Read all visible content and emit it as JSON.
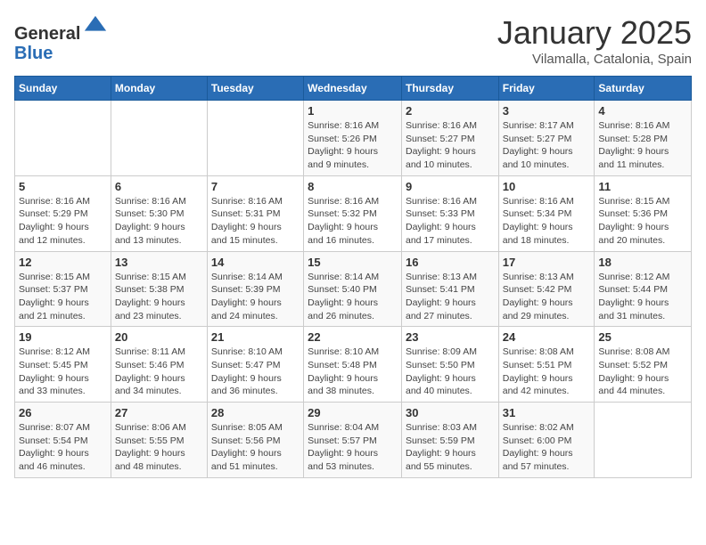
{
  "header": {
    "logo_general": "General",
    "logo_blue": "Blue",
    "month_title": "January 2025",
    "subtitle": "Vilamalla, Catalonia, Spain"
  },
  "weekdays": [
    "Sunday",
    "Monday",
    "Tuesday",
    "Wednesday",
    "Thursday",
    "Friday",
    "Saturday"
  ],
  "weeks": [
    [
      {
        "day": "",
        "info": ""
      },
      {
        "day": "",
        "info": ""
      },
      {
        "day": "",
        "info": ""
      },
      {
        "day": "1",
        "info": "Sunrise: 8:16 AM\nSunset: 5:26 PM\nDaylight: 9 hours\nand 9 minutes."
      },
      {
        "day": "2",
        "info": "Sunrise: 8:16 AM\nSunset: 5:27 PM\nDaylight: 9 hours\nand 10 minutes."
      },
      {
        "day": "3",
        "info": "Sunrise: 8:17 AM\nSunset: 5:27 PM\nDaylight: 9 hours\nand 10 minutes."
      },
      {
        "day": "4",
        "info": "Sunrise: 8:16 AM\nSunset: 5:28 PM\nDaylight: 9 hours\nand 11 minutes."
      }
    ],
    [
      {
        "day": "5",
        "info": "Sunrise: 8:16 AM\nSunset: 5:29 PM\nDaylight: 9 hours\nand 12 minutes."
      },
      {
        "day": "6",
        "info": "Sunrise: 8:16 AM\nSunset: 5:30 PM\nDaylight: 9 hours\nand 13 minutes."
      },
      {
        "day": "7",
        "info": "Sunrise: 8:16 AM\nSunset: 5:31 PM\nDaylight: 9 hours\nand 15 minutes."
      },
      {
        "day": "8",
        "info": "Sunrise: 8:16 AM\nSunset: 5:32 PM\nDaylight: 9 hours\nand 16 minutes."
      },
      {
        "day": "9",
        "info": "Sunrise: 8:16 AM\nSunset: 5:33 PM\nDaylight: 9 hours\nand 17 minutes."
      },
      {
        "day": "10",
        "info": "Sunrise: 8:16 AM\nSunset: 5:34 PM\nDaylight: 9 hours\nand 18 minutes."
      },
      {
        "day": "11",
        "info": "Sunrise: 8:15 AM\nSunset: 5:36 PM\nDaylight: 9 hours\nand 20 minutes."
      }
    ],
    [
      {
        "day": "12",
        "info": "Sunrise: 8:15 AM\nSunset: 5:37 PM\nDaylight: 9 hours\nand 21 minutes."
      },
      {
        "day": "13",
        "info": "Sunrise: 8:15 AM\nSunset: 5:38 PM\nDaylight: 9 hours\nand 23 minutes."
      },
      {
        "day": "14",
        "info": "Sunrise: 8:14 AM\nSunset: 5:39 PM\nDaylight: 9 hours\nand 24 minutes."
      },
      {
        "day": "15",
        "info": "Sunrise: 8:14 AM\nSunset: 5:40 PM\nDaylight: 9 hours\nand 26 minutes."
      },
      {
        "day": "16",
        "info": "Sunrise: 8:13 AM\nSunset: 5:41 PM\nDaylight: 9 hours\nand 27 minutes."
      },
      {
        "day": "17",
        "info": "Sunrise: 8:13 AM\nSunset: 5:42 PM\nDaylight: 9 hours\nand 29 minutes."
      },
      {
        "day": "18",
        "info": "Sunrise: 8:12 AM\nSunset: 5:44 PM\nDaylight: 9 hours\nand 31 minutes."
      }
    ],
    [
      {
        "day": "19",
        "info": "Sunrise: 8:12 AM\nSunset: 5:45 PM\nDaylight: 9 hours\nand 33 minutes."
      },
      {
        "day": "20",
        "info": "Sunrise: 8:11 AM\nSunset: 5:46 PM\nDaylight: 9 hours\nand 34 minutes."
      },
      {
        "day": "21",
        "info": "Sunrise: 8:10 AM\nSunset: 5:47 PM\nDaylight: 9 hours\nand 36 minutes."
      },
      {
        "day": "22",
        "info": "Sunrise: 8:10 AM\nSunset: 5:48 PM\nDaylight: 9 hours\nand 38 minutes."
      },
      {
        "day": "23",
        "info": "Sunrise: 8:09 AM\nSunset: 5:50 PM\nDaylight: 9 hours\nand 40 minutes."
      },
      {
        "day": "24",
        "info": "Sunrise: 8:08 AM\nSunset: 5:51 PM\nDaylight: 9 hours\nand 42 minutes."
      },
      {
        "day": "25",
        "info": "Sunrise: 8:08 AM\nSunset: 5:52 PM\nDaylight: 9 hours\nand 44 minutes."
      }
    ],
    [
      {
        "day": "26",
        "info": "Sunrise: 8:07 AM\nSunset: 5:54 PM\nDaylight: 9 hours\nand 46 minutes."
      },
      {
        "day": "27",
        "info": "Sunrise: 8:06 AM\nSunset: 5:55 PM\nDaylight: 9 hours\nand 48 minutes."
      },
      {
        "day": "28",
        "info": "Sunrise: 8:05 AM\nSunset: 5:56 PM\nDaylight: 9 hours\nand 51 minutes."
      },
      {
        "day": "29",
        "info": "Sunrise: 8:04 AM\nSunset: 5:57 PM\nDaylight: 9 hours\nand 53 minutes."
      },
      {
        "day": "30",
        "info": "Sunrise: 8:03 AM\nSunset: 5:59 PM\nDaylight: 9 hours\nand 55 minutes."
      },
      {
        "day": "31",
        "info": "Sunrise: 8:02 AM\nSunset: 6:00 PM\nDaylight: 9 hours\nand 57 minutes."
      },
      {
        "day": "",
        "info": ""
      }
    ]
  ]
}
